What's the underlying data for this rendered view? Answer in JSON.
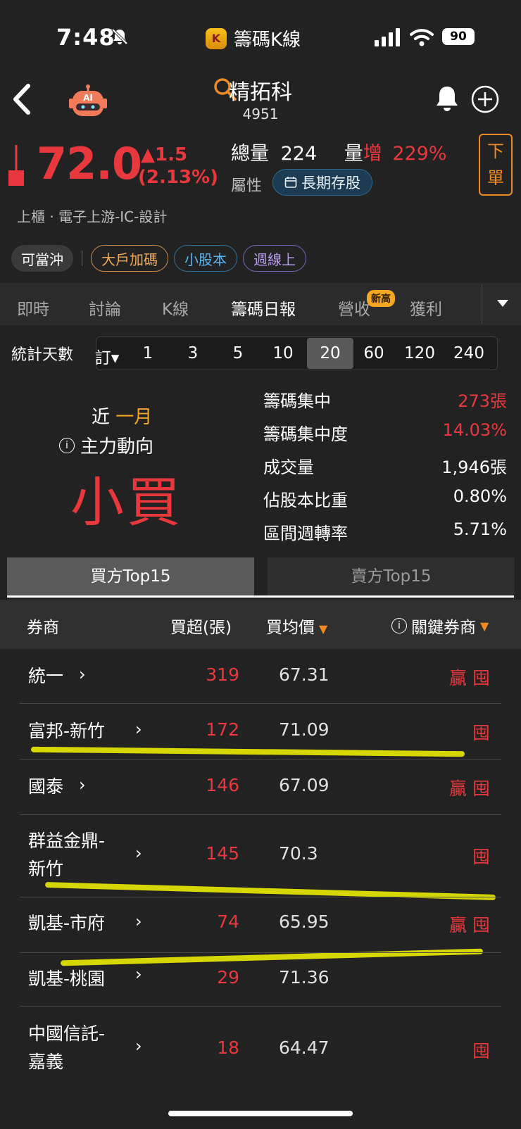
{
  "status": {
    "time": "7:48",
    "app_name": "籌碼K線",
    "battery": "90"
  },
  "header": {
    "stock_name": "精拓科",
    "stock_code": "4951",
    "price": "72.0",
    "change": "▲1.5",
    "change_pct": "(2.13%)",
    "volume_label": "總量",
    "volume": "224",
    "vol_inc_label": "量",
    "vol_inc_word": "增",
    "vol_inc_pct": "229%",
    "attr_label": "屬性",
    "attr_tag": "長期存股",
    "order_label_1": "下",
    "order_label_2": "單",
    "industry": "上櫃 · 電子上游-IC-設計"
  },
  "tags": [
    "可當沖",
    "大戶加碼",
    "小股本",
    "週線上"
  ],
  "tabs": [
    "即時",
    "討論",
    "K線",
    "籌碼日報",
    "營收",
    "獲利"
  ],
  "new_badge": "新高",
  "days": {
    "label": "統計天數",
    "sub": "訂▾",
    "options": [
      "1",
      "3",
      "5",
      "10",
      "20",
      "60",
      "120",
      "240"
    ],
    "selected": "20"
  },
  "summary": {
    "near": "近",
    "period": "一月",
    "trend_label": "主力動向",
    "trend": "小買"
  },
  "stats": [
    {
      "label": "籌碼集中",
      "value": "273張"
    },
    {
      "label": "籌碼集中度",
      "value": "14.03%"
    },
    {
      "label": "成交量",
      "value": "1,946張"
    },
    {
      "label": "佔股本比重",
      "value": "0.80%"
    },
    {
      "label": "區間週轉率",
      "value": "5.71%"
    }
  ],
  "buy_tab": "買方Top15",
  "sell_tab": "賣方Top15",
  "table_header": {
    "broker": "券商",
    "net": "買超(張)",
    "avg": "買均價",
    "key": "關鍵券商"
  },
  "rows": [
    {
      "broker_1": "統一",
      "broker_2": "",
      "net": "319",
      "avg": "67.31",
      "win": "贏",
      "hold": "囤"
    },
    {
      "broker_1": "富邦-新竹",
      "broker_2": "",
      "net": "172",
      "avg": "71.09",
      "win": "",
      "hold": "囤"
    },
    {
      "broker_1": "國泰",
      "broker_2": "",
      "net": "146",
      "avg": "67.09",
      "win": "贏",
      "hold": "囤"
    },
    {
      "broker_1": "群益金鼎-",
      "broker_2": "新竹",
      "net": "145",
      "avg": "70.3",
      "win": "",
      "hold": "囤"
    },
    {
      "broker_1": "凱基-市府",
      "broker_2": "",
      "net": "74",
      "avg": "65.95",
      "win": "贏",
      "hold": "囤"
    },
    {
      "broker_1": "凱基-桃園",
      "broker_2": "",
      "net": "29",
      "avg": "71.36",
      "win": "",
      "hold": ""
    },
    {
      "broker_1": "中國信託-",
      "broker_2": "嘉義",
      "net": "18",
      "avg": "64.47",
      "win": "",
      "hold": "囤"
    }
  ],
  "colors": {
    "up": "#e8383d",
    "accent": "#f5a623",
    "background": "#222222",
    "highlight": "#e6e600"
  },
  "icons": [
    "back-arrow-icon",
    "ai-robot-icon",
    "search-icon",
    "bell-icon",
    "add-circle-icon",
    "calendar-icon",
    "info-icon",
    "dropdown-triangle-icon",
    "chevron-right-icon"
  ]
}
